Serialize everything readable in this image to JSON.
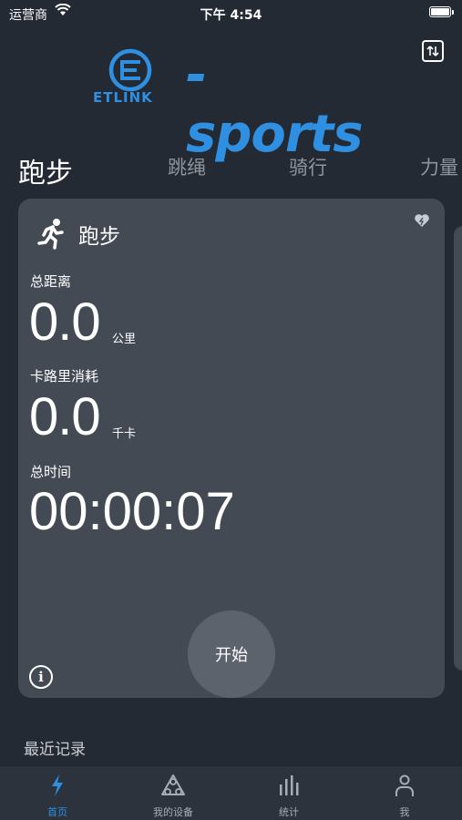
{
  "status_bar": {
    "carrier": "运营商",
    "time": "下午 4:54"
  },
  "logo": {
    "brand": "ETLINK",
    "title": "-sports",
    "color": "#2f8fe0"
  },
  "sport_tabs": [
    {
      "label": "跑步",
      "active": true
    },
    {
      "label": "跳绳",
      "active": false
    },
    {
      "label": "骑行",
      "active": false
    },
    {
      "label": "力量",
      "active": false
    }
  ],
  "card": {
    "title": "跑步",
    "icon": "running-person-icon",
    "distance": {
      "label": "总距离",
      "value": "0.0",
      "unit": "公里"
    },
    "calories": {
      "label": "卡路里消耗",
      "value": "0.0",
      "unit": "千卡"
    },
    "duration": {
      "label": "总时间",
      "value": "00:00:07"
    },
    "start_label": "开始"
  },
  "recent": {
    "title": "最近记录"
  },
  "tab_bar": [
    {
      "label": "首页",
      "icon": "lightning-icon",
      "active": true
    },
    {
      "label": "我的设备",
      "icon": "device-icon",
      "active": false
    },
    {
      "label": "统计",
      "icon": "bar-chart-icon",
      "active": false
    },
    {
      "label": "我",
      "icon": "person-icon",
      "active": false
    }
  ],
  "colors": {
    "background": "#242a33",
    "card": "#434a54",
    "accent": "#2f8fe0"
  }
}
